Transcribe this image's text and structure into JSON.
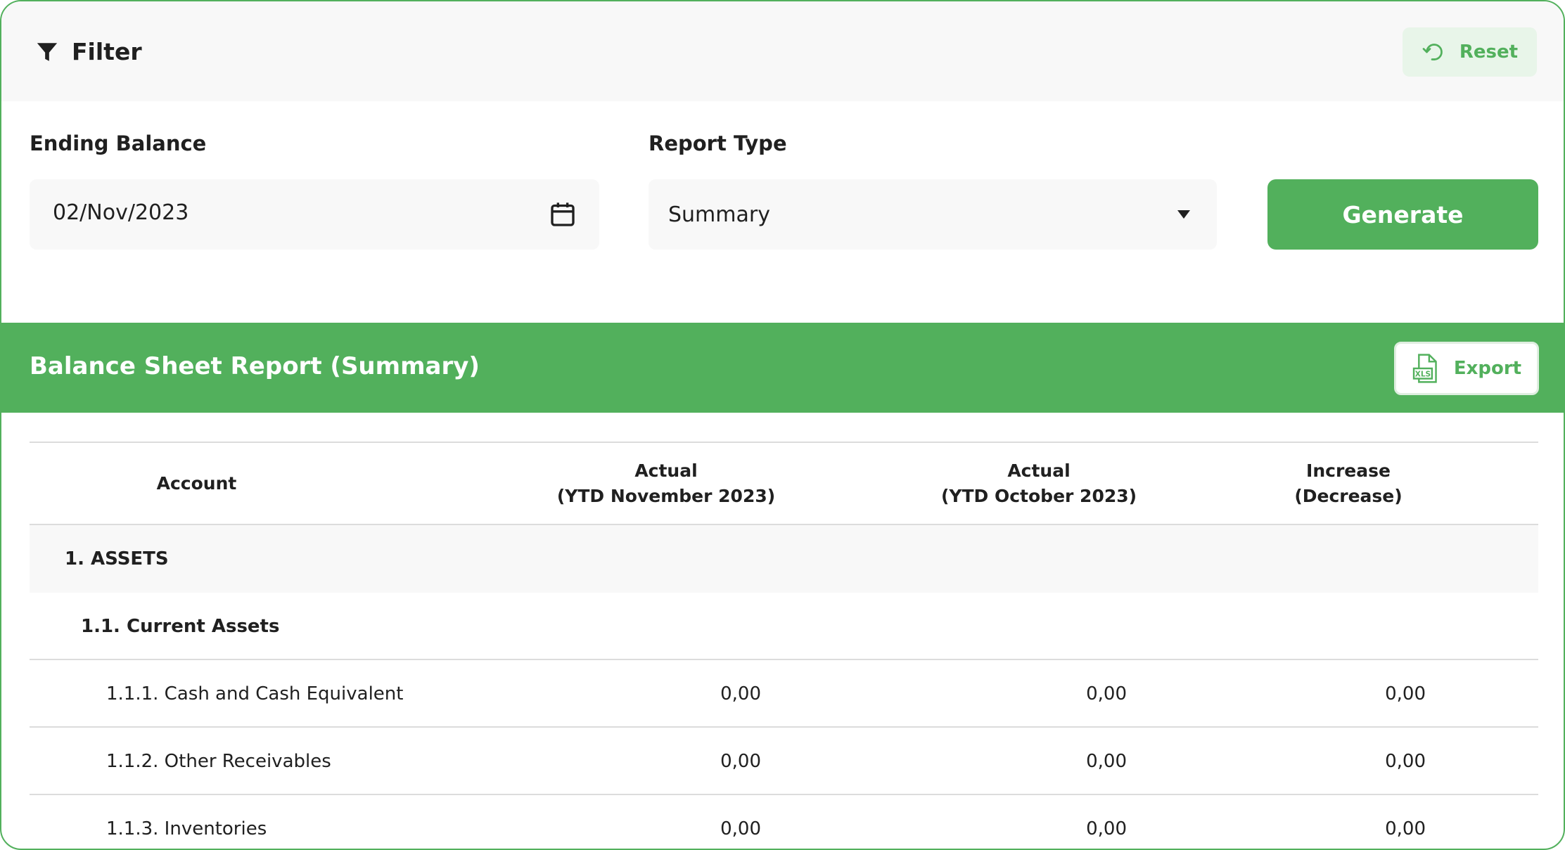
{
  "filter": {
    "title": "Filter",
    "reset_label": "Reset"
  },
  "form": {
    "ending_balance_label": "Ending Balance",
    "ending_balance_value": "02/Nov/2023",
    "report_type_label": "Report Type",
    "report_type_value": "Summary",
    "generate_label": "Generate"
  },
  "report": {
    "title": "Balance Sheet Report (Summary)",
    "export_label": "Export",
    "xls_text": "XLS",
    "columns": {
      "account": "Account",
      "ytd_nov_line1": "Actual",
      "ytd_nov_line2": "(YTD November 2023)",
      "ytd_oct_line1": "Actual",
      "ytd_oct_line2": "(YTD October 2023)",
      "increase_line1": "Increase",
      "increase_line2": "(Decrease)"
    },
    "rows": [
      {
        "account": "1. ASSETS",
        "nov": "",
        "oct": "",
        "inc": ""
      },
      {
        "account": "1.1. Current Assets",
        "nov": "",
        "oct": "",
        "inc": ""
      },
      {
        "account": "1.1.1. Cash and Cash Equivalent",
        "nov": "0,00",
        "oct": "0,00",
        "inc": "0,00"
      },
      {
        "account": "1.1.2. Other Receivables",
        "nov": "0,00",
        "oct": "0,00",
        "inc": "0,00"
      },
      {
        "account": "1.1.3. Inventories",
        "nov": "0,00",
        "oct": "0,00",
        "inc": "0,00"
      }
    ]
  },
  "colors": {
    "primary_green": "#52b05c",
    "light_green": "#e8f5e9",
    "panel_gray": "#f8f8f8"
  },
  "icons": {
    "filter": "filter-icon",
    "reset": "reset-icon",
    "calendar": "calendar-icon",
    "dropdown": "chevron-down-icon",
    "export": "xls-file-icon"
  }
}
